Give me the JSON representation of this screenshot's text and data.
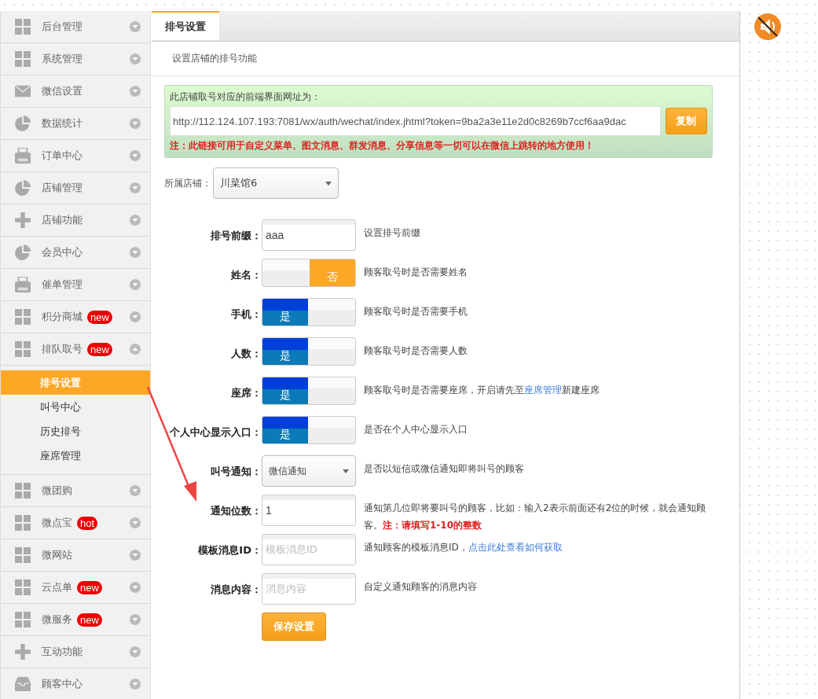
{
  "sidebar": {
    "items": [
      {
        "label": "后台管理",
        "kind": "grid",
        "expanded": false
      },
      {
        "label": "系统管理",
        "kind": "grid",
        "expanded": false
      },
      {
        "label": "微信设置",
        "kind": "mail",
        "expanded": false
      },
      {
        "label": "数据统计",
        "kind": "pie",
        "expanded": false
      },
      {
        "label": "订单中心",
        "kind": "printer",
        "expanded": false
      },
      {
        "label": "店铺管理",
        "kind": "pie",
        "expanded": false
      },
      {
        "label": "店铺功能",
        "kind": "plus",
        "expanded": false
      },
      {
        "label": "会员中心",
        "kind": "pie",
        "expanded": false
      },
      {
        "label": "催单管理",
        "kind": "printer",
        "expanded": false
      },
      {
        "label": "积分商城",
        "kind": "grid",
        "badge": "new",
        "expanded": false
      },
      {
        "label": "排队取号",
        "kind": "grid",
        "badge": "new",
        "expanded": true,
        "children": [
          {
            "label": "排号设置",
            "selected": true
          },
          {
            "label": "叫号中心",
            "selected": false
          },
          {
            "label": "历史排号",
            "selected": false
          },
          {
            "label": "座席管理",
            "selected": false
          }
        ]
      },
      {
        "label": "微团购",
        "kind": "grid",
        "expanded": false
      },
      {
        "label": "微点宝",
        "kind": "grid",
        "badge": "hot",
        "expanded": false
      },
      {
        "label": "微网站",
        "kind": "grid",
        "expanded": false
      },
      {
        "label": "云点单",
        "kind": "grid",
        "badge": "new",
        "expanded": false
      },
      {
        "label": "微服务",
        "kind": "grid",
        "badge": "new",
        "expanded": false
      },
      {
        "label": "互动功能",
        "kind": "plus",
        "expanded": false
      },
      {
        "label": "顾客中心",
        "kind": "tray",
        "expanded": false
      }
    ]
  },
  "tabs": [
    {
      "label": "排号设置",
      "selected": true
    }
  ],
  "subtitle": "设置店铺的排号功能",
  "url_box": {
    "title": "此店铺取号对应的前端界面网址为：",
    "value": "http://112.124.107.193:7081/wx/auth/wechat/index.jhtml?token=9ba2a3e11e2d0c8269b7ccf6aa9dac",
    "copy_button": "复制",
    "note": "注：此链接可用于自定义菜单、图文消息、群发消息、分享信息等一切可以在微信上跳转的地方使用！"
  },
  "store": {
    "label": "所属店铺：",
    "value": "川菜馆6"
  },
  "form": [
    {
      "kind": "input",
      "label": "排号前缀：",
      "value": "aaa",
      "hint": "设置排号前缀"
    },
    {
      "kind": "toggle",
      "label": "姓名：",
      "on": false,
      "text": "否",
      "hint": "顾客取号时是否需要姓名"
    },
    {
      "kind": "toggle",
      "label": "手机：",
      "on": true,
      "text": "是",
      "hint": "顾客取号时是否需要手机"
    },
    {
      "kind": "toggle",
      "label": "人数：",
      "on": true,
      "text": "是",
      "hint": "顾客取号时是否需要人数"
    },
    {
      "kind": "toggle",
      "label": "座席：",
      "on": true,
      "text": "是",
      "hint": "顾客取号时是否需要座席，开启请先至",
      "link": "座席管理",
      "hint_after": "新建座席"
    },
    {
      "kind": "toggle",
      "label": "个人中心显示入口：",
      "on": true,
      "text": "是",
      "hint": "是否在个人中心显示入口"
    },
    {
      "kind": "select",
      "label": "叫号通知：",
      "value": "微信通知",
      "hint": "是否以短信或微信通知即将叫号的顾客"
    },
    {
      "kind": "input",
      "label": "通知位数：",
      "value": "1",
      "hint": "通知第几位即将要叫号的顾客，比如：输入2表示前面还有2位的时候，就会通知顾客。",
      "note": "注：请填写1-10的整数"
    },
    {
      "kind": "input",
      "label": "模板消息ID：",
      "placeholder": "模板消息ID",
      "hint": "通知顾客的模板消息ID，",
      "link": "点击此处查看如何获取"
    },
    {
      "kind": "input",
      "label": "消息内容：",
      "placeholder": "消息内容",
      "hint": "自定义通知顾客的消息内容"
    }
  ],
  "save_button": "保存设置"
}
